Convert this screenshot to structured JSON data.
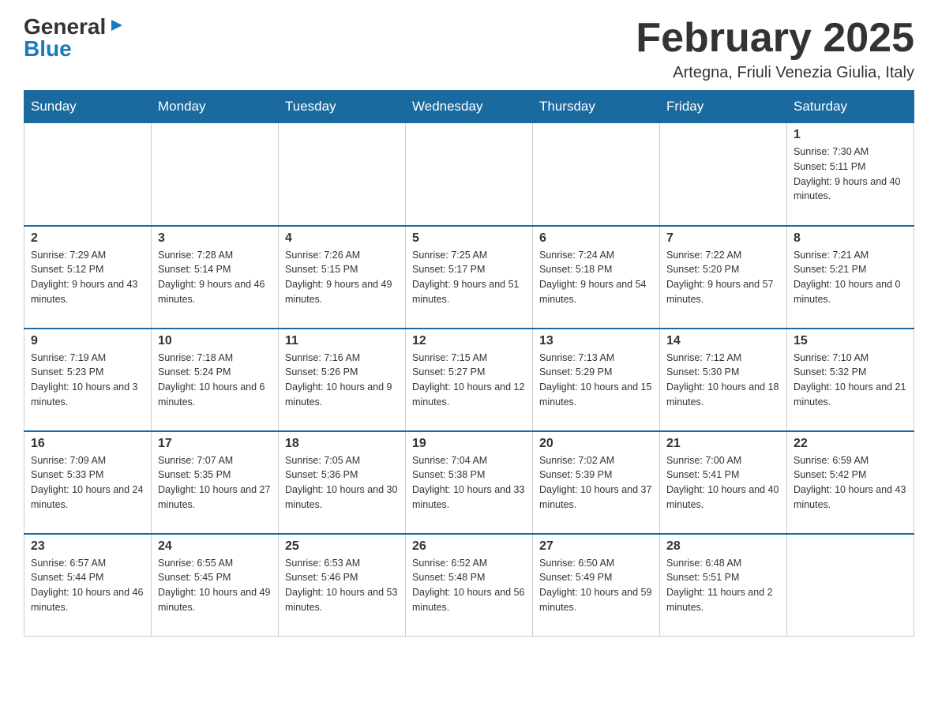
{
  "header": {
    "title": "February 2025",
    "subtitle": "Artegna, Friuli Venezia Giulia, Italy",
    "logo_general": "General",
    "logo_blue": "Blue"
  },
  "days_of_week": [
    "Sunday",
    "Monday",
    "Tuesday",
    "Wednesday",
    "Thursday",
    "Friday",
    "Saturday"
  ],
  "weeks": [
    {
      "days": [
        {
          "date": "",
          "info": ""
        },
        {
          "date": "",
          "info": ""
        },
        {
          "date": "",
          "info": ""
        },
        {
          "date": "",
          "info": ""
        },
        {
          "date": "",
          "info": ""
        },
        {
          "date": "",
          "info": ""
        },
        {
          "date": "1",
          "info": "Sunrise: 7:30 AM\nSunset: 5:11 PM\nDaylight: 9 hours and 40 minutes."
        }
      ]
    },
    {
      "days": [
        {
          "date": "2",
          "info": "Sunrise: 7:29 AM\nSunset: 5:12 PM\nDaylight: 9 hours and 43 minutes."
        },
        {
          "date": "3",
          "info": "Sunrise: 7:28 AM\nSunset: 5:14 PM\nDaylight: 9 hours and 46 minutes."
        },
        {
          "date": "4",
          "info": "Sunrise: 7:26 AM\nSunset: 5:15 PM\nDaylight: 9 hours and 49 minutes."
        },
        {
          "date": "5",
          "info": "Sunrise: 7:25 AM\nSunset: 5:17 PM\nDaylight: 9 hours and 51 minutes."
        },
        {
          "date": "6",
          "info": "Sunrise: 7:24 AM\nSunset: 5:18 PM\nDaylight: 9 hours and 54 minutes."
        },
        {
          "date": "7",
          "info": "Sunrise: 7:22 AM\nSunset: 5:20 PM\nDaylight: 9 hours and 57 minutes."
        },
        {
          "date": "8",
          "info": "Sunrise: 7:21 AM\nSunset: 5:21 PM\nDaylight: 10 hours and 0 minutes."
        }
      ]
    },
    {
      "days": [
        {
          "date": "9",
          "info": "Sunrise: 7:19 AM\nSunset: 5:23 PM\nDaylight: 10 hours and 3 minutes."
        },
        {
          "date": "10",
          "info": "Sunrise: 7:18 AM\nSunset: 5:24 PM\nDaylight: 10 hours and 6 minutes."
        },
        {
          "date": "11",
          "info": "Sunrise: 7:16 AM\nSunset: 5:26 PM\nDaylight: 10 hours and 9 minutes."
        },
        {
          "date": "12",
          "info": "Sunrise: 7:15 AM\nSunset: 5:27 PM\nDaylight: 10 hours and 12 minutes."
        },
        {
          "date": "13",
          "info": "Sunrise: 7:13 AM\nSunset: 5:29 PM\nDaylight: 10 hours and 15 minutes."
        },
        {
          "date": "14",
          "info": "Sunrise: 7:12 AM\nSunset: 5:30 PM\nDaylight: 10 hours and 18 minutes."
        },
        {
          "date": "15",
          "info": "Sunrise: 7:10 AM\nSunset: 5:32 PM\nDaylight: 10 hours and 21 minutes."
        }
      ]
    },
    {
      "days": [
        {
          "date": "16",
          "info": "Sunrise: 7:09 AM\nSunset: 5:33 PM\nDaylight: 10 hours and 24 minutes."
        },
        {
          "date": "17",
          "info": "Sunrise: 7:07 AM\nSunset: 5:35 PM\nDaylight: 10 hours and 27 minutes."
        },
        {
          "date": "18",
          "info": "Sunrise: 7:05 AM\nSunset: 5:36 PM\nDaylight: 10 hours and 30 minutes."
        },
        {
          "date": "19",
          "info": "Sunrise: 7:04 AM\nSunset: 5:38 PM\nDaylight: 10 hours and 33 minutes."
        },
        {
          "date": "20",
          "info": "Sunrise: 7:02 AM\nSunset: 5:39 PM\nDaylight: 10 hours and 37 minutes."
        },
        {
          "date": "21",
          "info": "Sunrise: 7:00 AM\nSunset: 5:41 PM\nDaylight: 10 hours and 40 minutes."
        },
        {
          "date": "22",
          "info": "Sunrise: 6:59 AM\nSunset: 5:42 PM\nDaylight: 10 hours and 43 minutes."
        }
      ]
    },
    {
      "days": [
        {
          "date": "23",
          "info": "Sunrise: 6:57 AM\nSunset: 5:44 PM\nDaylight: 10 hours and 46 minutes."
        },
        {
          "date": "24",
          "info": "Sunrise: 6:55 AM\nSunset: 5:45 PM\nDaylight: 10 hours and 49 minutes."
        },
        {
          "date": "25",
          "info": "Sunrise: 6:53 AM\nSunset: 5:46 PM\nDaylight: 10 hours and 53 minutes."
        },
        {
          "date": "26",
          "info": "Sunrise: 6:52 AM\nSunset: 5:48 PM\nDaylight: 10 hours and 56 minutes."
        },
        {
          "date": "27",
          "info": "Sunrise: 6:50 AM\nSunset: 5:49 PM\nDaylight: 10 hours and 59 minutes."
        },
        {
          "date": "28",
          "info": "Sunrise: 6:48 AM\nSunset: 5:51 PM\nDaylight: 11 hours and 2 minutes."
        },
        {
          "date": "",
          "info": ""
        }
      ]
    }
  ]
}
